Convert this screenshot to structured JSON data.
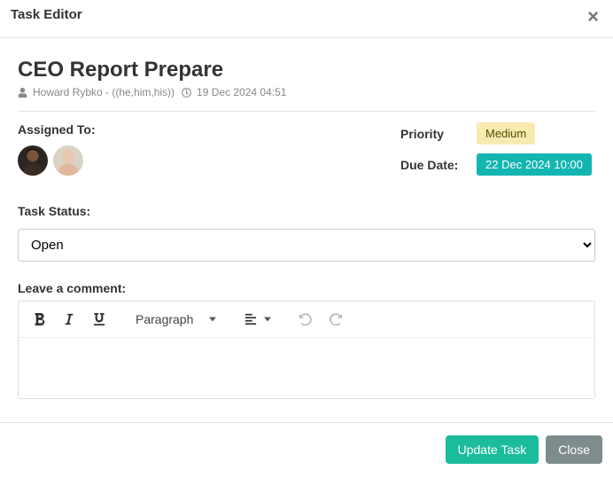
{
  "modal": {
    "title": "Task Editor",
    "close_glyph": "×"
  },
  "task": {
    "title": "CEO Report Prepare",
    "author": "Howard Rybko - ((he,him,his))",
    "created_at": "19 Dec 2024 04:51"
  },
  "assigned": {
    "label": "Assigned To:"
  },
  "priority": {
    "label": "Priority",
    "value": "Medium"
  },
  "due": {
    "label": "Due Date:",
    "value": "22 Dec 2024 10:00"
  },
  "status": {
    "label": "Task Status:",
    "selected": "Open"
  },
  "comment": {
    "label": "Leave a comment:",
    "paragraph_label": "Paragraph"
  },
  "footer": {
    "update": "Update Task",
    "close": "Close"
  }
}
